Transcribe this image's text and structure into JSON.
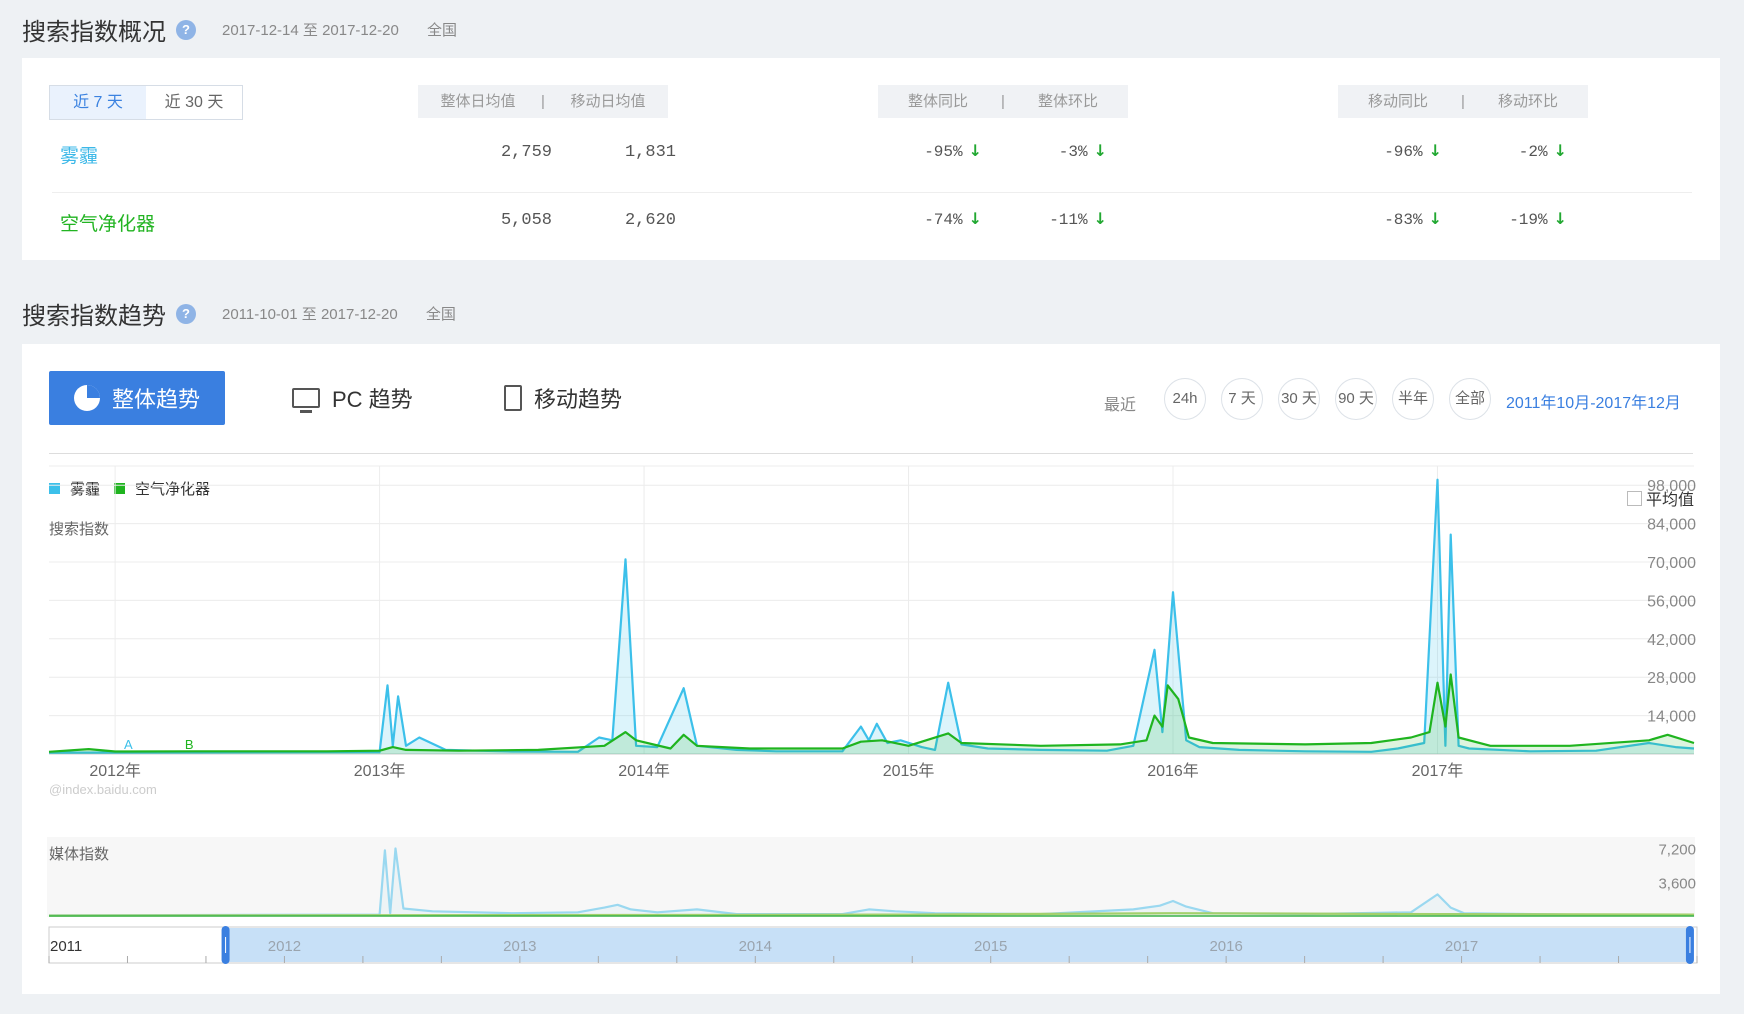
{
  "overview": {
    "title": "搜索指数概况",
    "help": "?",
    "date_range": "2017-12-14 至 2017-12-20",
    "region": "全国",
    "tabs": [
      "近 7 天",
      "近 30 天"
    ],
    "group1": [
      "整体日均值",
      "|",
      "移动日均值"
    ],
    "group2": [
      "整体同比",
      "|",
      "整体环比"
    ],
    "group3": [
      "移动同比",
      "|",
      "移动环比"
    ],
    "rows": [
      {
        "keyword": "雾霾",
        "color": "#3cb8e8",
        "overall_avg": "2,759",
        "mobile_avg": "1,831",
        "overall_yoy": "-95%",
        "overall_mom": "-3%",
        "mobile_yoy": "-96%",
        "mobile_mom": "-2%"
      },
      {
        "keyword": "空气净化器",
        "color": "#22b422",
        "overall_avg": "5,058",
        "mobile_avg": "2,620",
        "overall_yoy": "-74%",
        "overall_mom": "-11%",
        "mobile_yoy": "-83%",
        "mobile_mom": "-19%"
      }
    ],
    "arrow": "↓"
  },
  "trend": {
    "title": "搜索指数趋势",
    "help": "?",
    "date_range": "2011-10-01 至 2017-12-20",
    "region": "全国",
    "modes": [
      "整体趋势",
      "PC 趋势",
      "移动趋势"
    ],
    "recent_label": "最近",
    "range_buttons": [
      "24h",
      "7 天",
      "30 天",
      "90 天",
      "半年",
      "全部"
    ],
    "selected_range": "2011年10月-2017年12月",
    "average_label": "平均值",
    "watermark": "@index.baidu.com",
    "colors": {
      "smog": "#3cc0ea",
      "purifier": "#1fb41f",
      "accent": "#3a7fe0"
    }
  },
  "chart_data": [
    {
      "type": "area",
      "ylabel": "搜索指数",
      "ylim": [
        0,
        105000
      ],
      "yticks": [
        14000,
        28000,
        42000,
        56000,
        70000,
        84000,
        98000
      ],
      "ytick_labels": [
        "14,000",
        "28,000",
        "42,000",
        "56,000",
        "70,000",
        "84,000",
        "98,000"
      ],
      "x_tick_labels": [
        "2012年",
        "2013年",
        "2014年",
        "2015年",
        "2016年",
        "2017年"
      ],
      "x_tick_values": [
        2012,
        2013,
        2014,
        2015,
        2016,
        2017
      ],
      "xlim": [
        2011.75,
        2017.97
      ],
      "legend": [
        "雾霾",
        "空气净化器"
      ],
      "annotations": [
        "A",
        "B"
      ],
      "series": [
        {
          "name": "雾霾",
          "color": "#3cc0ea",
          "points": [
            [
              2011.75,
              500
            ],
            [
              2012.3,
              600
            ],
            [
              2012.8,
              700
            ],
            [
              2013.0,
              700
            ],
            [
              2013.03,
              25000
            ],
            [
              2013.05,
              3000
            ],
            [
              2013.07,
              21000
            ],
            [
              2013.1,
              3000
            ],
            [
              2013.15,
              6000
            ],
            [
              2013.25,
              1500
            ],
            [
              2013.5,
              900
            ],
            [
              2013.75,
              800
            ],
            [
              2013.83,
              6000
            ],
            [
              2013.88,
              5000
            ],
            [
              2013.93,
              71000
            ],
            [
              2013.97,
              3000
            ],
            [
              2014.05,
              2500
            ],
            [
              2014.15,
              24000
            ],
            [
              2014.2,
              3000
            ],
            [
              2014.35,
              1500
            ],
            [
              2014.5,
              1000
            ],
            [
              2014.75,
              1000
            ],
            [
              2014.82,
              10000
            ],
            [
              2014.85,
              5000
            ],
            [
              2014.88,
              11000
            ],
            [
              2014.92,
              4000
            ],
            [
              2014.97,
              5000
            ],
            [
              2015.05,
              2500
            ],
            [
              2015.1,
              1500
            ],
            [
              2015.15,
              26000
            ],
            [
              2015.2,
              3500
            ],
            [
              2015.3,
              2000
            ],
            [
              2015.5,
              1500
            ],
            [
              2015.75,
              1200
            ],
            [
              2015.85,
              3000
            ],
            [
              2015.93,
              38000
            ],
            [
              2015.96,
              8000
            ],
            [
              2016.0,
              59000
            ],
            [
              2016.05,
              5000
            ],
            [
              2016.1,
              2500
            ],
            [
              2016.25,
              1500
            ],
            [
              2016.5,
              1000
            ],
            [
              2016.75,
              800
            ],
            [
              2016.85,
              2000
            ],
            [
              2016.95,
              4000
            ],
            [
              2017.0,
              100000
            ],
            [
              2017.03,
              3000
            ],
            [
              2017.05,
              80000
            ],
            [
              2017.08,
              3000
            ],
            [
              2017.12,
              2000
            ],
            [
              2017.35,
              1000
            ],
            [
              2017.6,
              1200
            ],
            [
              2017.8,
              4000
            ],
            [
              2017.9,
              2500
            ],
            [
              2017.97,
              2000
            ]
          ]
        },
        {
          "name": "空气净化器",
          "color": "#1fb41f",
          "points": [
            [
              2011.75,
              800
            ],
            [
              2011.9,
              1800
            ],
            [
              2012.0,
              900
            ],
            [
              2012.3,
              1000
            ],
            [
              2012.8,
              1000
            ],
            [
              2013.0,
              1200
            ],
            [
              2013.05,
              2500
            ],
            [
              2013.1,
              1500
            ],
            [
              2013.3,
              1200
            ],
            [
              2013.6,
              1500
            ],
            [
              2013.85,
              3000
            ],
            [
              2013.93,
              8000
            ],
            [
              2013.97,
              5000
            ],
            [
              2014.1,
              2000
            ],
            [
              2014.15,
              7000
            ],
            [
              2014.2,
              3000
            ],
            [
              2014.4,
              2000
            ],
            [
              2014.75,
              2000
            ],
            [
              2014.82,
              4500
            ],
            [
              2014.9,
              5000
            ],
            [
              2015.0,
              3000
            ],
            [
              2015.15,
              7500
            ],
            [
              2015.2,
              4000
            ],
            [
              2015.5,
              3000
            ],
            [
              2015.8,
              3500
            ],
            [
              2015.9,
              5000
            ],
            [
              2015.93,
              14000
            ],
            [
              2015.96,
              10000
            ],
            [
              2015.98,
              25000
            ],
            [
              2016.02,
              20000
            ],
            [
              2016.06,
              6000
            ],
            [
              2016.15,
              4000
            ],
            [
              2016.5,
              3500
            ],
            [
              2016.75,
              4000
            ],
            [
              2016.9,
              6000
            ],
            [
              2016.97,
              8000
            ],
            [
              2017.0,
              26000
            ],
            [
              2017.03,
              10000
            ],
            [
              2017.05,
              29000
            ],
            [
              2017.08,
              6000
            ],
            [
              2017.2,
              3000
            ],
            [
              2017.5,
              3000
            ],
            [
              2017.8,
              5000
            ],
            [
              2017.87,
              7000
            ],
            [
              2017.97,
              4000
            ]
          ]
        }
      ]
    },
    {
      "type": "area",
      "ylabel": "媒体指数",
      "ylim": [
        0,
        8000
      ],
      "yticks": [
        3600,
        7200
      ],
      "ytick_labels": [
        "3,600",
        "7,200"
      ],
      "xlim": [
        2011.75,
        2017.97
      ],
      "series": [
        {
          "name": "雾霾",
          "color": "#9ad8f0",
          "points": [
            [
              2011.75,
              60
            ],
            [
              2013.0,
              150
            ],
            [
              2013.02,
              7000
            ],
            [
              2013.04,
              300
            ],
            [
              2013.06,
              7200
            ],
            [
              2013.09,
              800
            ],
            [
              2013.2,
              500
            ],
            [
              2013.5,
              300
            ],
            [
              2013.75,
              400
            ],
            [
              2013.85,
              900
            ],
            [
              2013.9,
              1200
            ],
            [
              2013.95,
              700
            ],
            [
              2014.05,
              400
            ],
            [
              2014.2,
              700
            ],
            [
              2014.35,
              200
            ],
            [
              2014.75,
              200
            ],
            [
              2014.85,
              700
            ],
            [
              2014.95,
              500
            ],
            [
              2015.1,
              300
            ],
            [
              2015.5,
              200
            ],
            [
              2015.85,
              700
            ],
            [
              2015.95,
              1100
            ],
            [
              2016.0,
              1600
            ],
            [
              2016.05,
              1000
            ],
            [
              2016.15,
              300
            ],
            [
              2016.5,
              200
            ],
            [
              2016.9,
              400
            ],
            [
              2017.0,
              2300
            ],
            [
              2017.05,
              900
            ],
            [
              2017.1,
              300
            ],
            [
              2017.5,
              150
            ],
            [
              2017.97,
              150
            ]
          ]
        },
        {
          "name": "空气净化器",
          "color": "#a3d06b",
          "points": [
            [
              2011.75,
              40
            ],
            [
              2012.5,
              60
            ],
            [
              2013.0,
              90
            ],
            [
              2014.0,
              110
            ],
            [
              2015.0,
              150
            ],
            [
              2016.0,
              300
            ],
            [
              2017.0,
              200
            ],
            [
              2017.97,
              150
            ]
          ]
        }
      ]
    },
    {
      "type": "area",
      "x_tick_labels": [
        "2011",
        "2012",
        "2013",
        "2014",
        "2015",
        "2016",
        "2017"
      ],
      "x_tick_values": [
        2011,
        2012,
        2013,
        2014,
        2015,
        2016,
        2017
      ],
      "xlim": [
        2011,
        2018
      ],
      "selection": [
        2011.75,
        2017.97
      ]
    }
  ]
}
